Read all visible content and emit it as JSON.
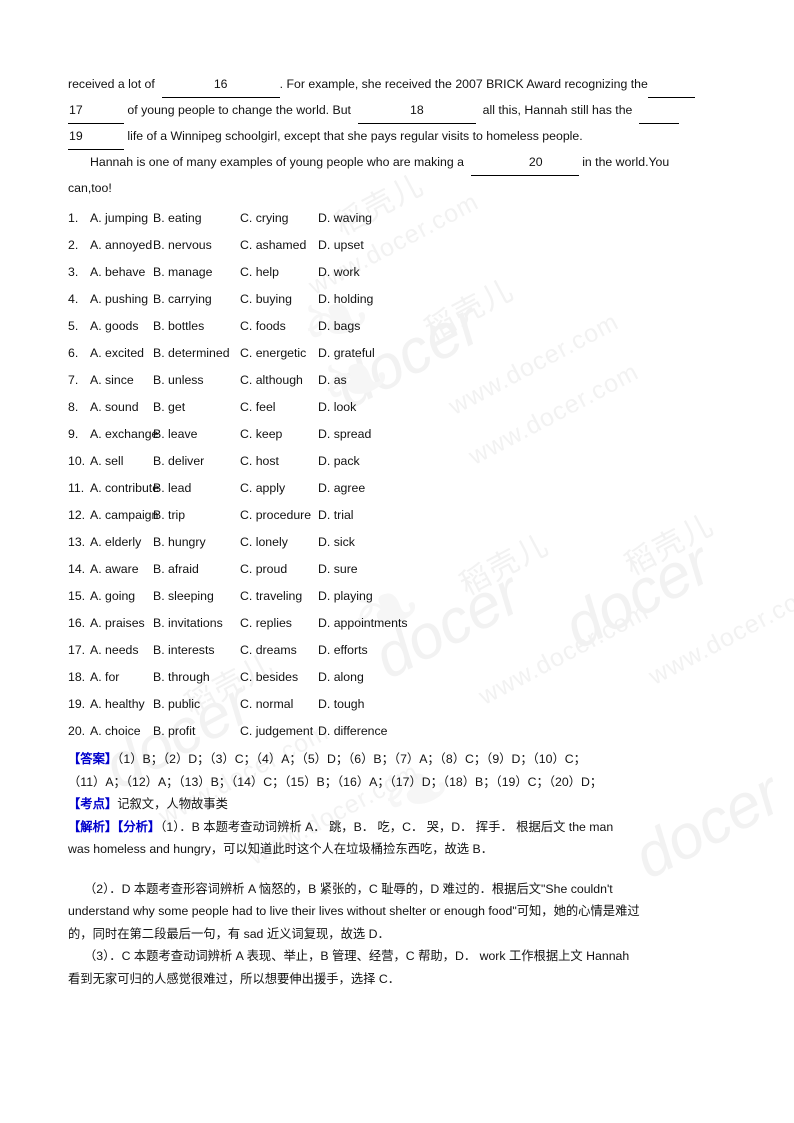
{
  "watermark": {
    "cn_text": "稻壳儿",
    "brand_text": "docer",
    "url_text": "www.docer.com",
    "leaf_glyph": "❧"
  },
  "passage": {
    "line1_a": "received a lot of",
    "line1_blank": "16",
    "line1_b": ".  For example, she received the 2007 BRICK Award recognizing the",
    "line2_blank": "17",
    "line2_a": "of young people  to change the world. But",
    "line2_blank2": "18",
    "line2_b": "all this, Hannah still has the",
    "line3_blank": "19",
    "line3_a": "life of a Winnipeg  schoolgirl, except that she pays regular visits to homeless people.",
    "line4_a": "Hannah is one of many examples of young people  who are making a",
    "line4_blank": "20",
    "line4_b": "in the world.You",
    "line5_a": "can,too!"
  },
  "options": [
    {
      "n": "1.",
      "a": "A. jumping",
      "b": "B. eating",
      "c": "C. crying",
      "d": "D. waving"
    },
    {
      "n": "2.",
      "a": "A. annoyed",
      "b": "B. nervous",
      "c": "C. ashamed",
      "d": "D. upset"
    },
    {
      "n": "3.",
      "a": "A. behave",
      "b": "B. manage",
      "c": "C. help",
      "d": "D. work"
    },
    {
      "n": "4.",
      "a": "A. pushing",
      "b": "B. carrying",
      "c": "C. buying",
      "d": "D. holding"
    },
    {
      "n": "5.",
      "a": "A. goods",
      "b": "B. bottles",
      "c": "C. foods",
      "d": "D. bags"
    },
    {
      "n": "6.",
      "a": "A.  excited",
      "b": "B. determined",
      "c": "C. energetic",
      "d": "D. grateful"
    },
    {
      "n": "7.",
      "a": "A. since",
      "b": "B. unless",
      "c": "C. although",
      "d": "D. as"
    },
    {
      "n": "8.",
      "a": "A. sound",
      "b": "B. get",
      "c": "C. feel",
      "d": "D. look"
    },
    {
      "n": "9.",
      "a": "A. exchange",
      "b": "B. leave",
      "c": "C. keep",
      "d": "D. spread"
    },
    {
      "n": "10.",
      "a": "A. sell",
      "b": "B. deliver",
      "c": "C. host",
      "d": "D. pack"
    },
    {
      "n": "11.",
      "a": "A. contribute",
      "b": "B. lead",
      "c": "C. apply",
      "d": "D. agree"
    },
    {
      "n": "12.",
      "a": "A. campaign",
      "b": "B. trip",
      "c": "C. procedure",
      "d": "D. trial"
    },
    {
      "n": "13.",
      "a": "A. elderly",
      "b": "B. hungry",
      "c": "C. lonely",
      "d": "D. sick"
    },
    {
      "n": "14.",
      "a": "A. aware",
      "b": "B. afraid",
      "c": "C. proud",
      "d": "D. sure"
    },
    {
      "n": "15.",
      "a": "A. going",
      "b": "B. sleeping",
      "c": "C. traveling",
      "d": "D. playing"
    },
    {
      "n": "16.",
      "a": "A.  praises",
      "b": "B. invitations",
      "c": "C. replies",
      "d": "D. appointments"
    },
    {
      "n": "17.",
      "a": "A. needs",
      "b": "B. interests",
      "c": "C. dreams",
      "d": "D. efforts"
    },
    {
      "n": "18.",
      "a": "A. for",
      "b": "B. through",
      "c": "C. besides",
      "d": "D. along"
    },
    {
      "n": "19.",
      "a": "A. healthy",
      "b": "B. public",
      "c": "C. normal",
      "d": "D. tough"
    },
    {
      "n": "20.",
      "a": "A. choice",
      "b": "B. profit",
      "c": "C. judgement",
      "d": "D. difference"
    }
  ],
  "explanation": {
    "answer_tag": "【答案】",
    "answer_line1": "（1）B；（2）D；（3）C；（4）A；（5）D；（6）B；（7）A；（8）C；（9）D；（10）C；",
    "answer_line2": "（11）A；（12）A；（13）B；（14）C；（15）B；（16）A；（17）D；（18）B；（19）C；（20）D；",
    "kaodian_tag": "【考点】",
    "kaodian_text": "记叙文，人物故事类",
    "jiexi_tag": "【解析】【分析】",
    "jiexi_1_line1": "（1）．B 本题考查动词辨析 A． 跳，B． 吃，C． 哭，D． 挥手． 根据后文 the man",
    "jiexi_1_line2": "was homeless and hungry，可以知道此时这个人在垃圾桶捡东西吃，故选 B．",
    "jiexi_2_line1": "（2）．D 本题考查形容词辨析 A 恼怒的，B 紧张的，C 耻辱的，D 难过的．根据后文\"She couldn't",
    "jiexi_2_line2": "understand why some people had to live their lives without shelter or enough food\"可知，她的心情是难过",
    "jiexi_2_line3": "的，同时在第二段最后一句，有 sad 近义词复现，故选 D．",
    "jiexi_3_line1": "（3）．C 本题考查动词辨析 A 表现、举止，B 管理、经营，C 帮助，D． work 工作根据上文 Hannah",
    "jiexi_3_line2": "看到无家可归的人感觉很难过，所以想要伸出援手，选择 C．"
  },
  "colors": {
    "tag_blue": "#0000cc",
    "text_black": "#111111",
    "watermark_gray": "#f2f2f2"
  }
}
